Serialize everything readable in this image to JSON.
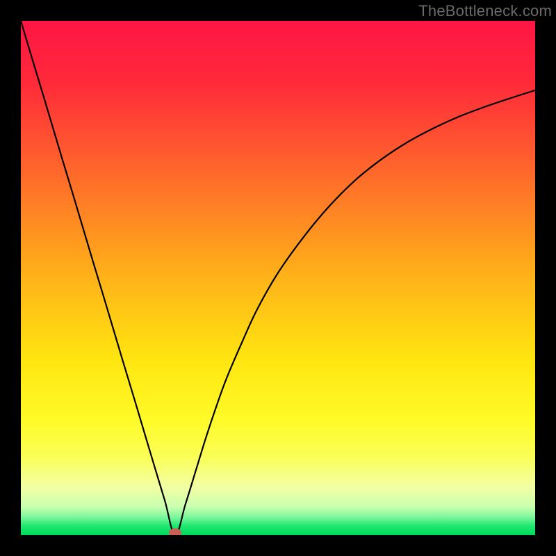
{
  "watermark": "TheBottleneck.com",
  "chart_data": {
    "type": "line",
    "title": "",
    "xlabel": "",
    "ylabel": "",
    "xlim": [
      0,
      100
    ],
    "ylim": [
      0,
      100
    ],
    "gradient_stops": [
      {
        "offset": 0,
        "color": "#ff1544"
      },
      {
        "offset": 0.12,
        "color": "#ff2a3a"
      },
      {
        "offset": 0.3,
        "color": "#ff6a2a"
      },
      {
        "offset": 0.5,
        "color": "#ffb319"
      },
      {
        "offset": 0.66,
        "color": "#ffe610"
      },
      {
        "offset": 0.78,
        "color": "#fffb2a"
      },
      {
        "offset": 0.85,
        "color": "#faff59"
      },
      {
        "offset": 0.905,
        "color": "#f4ffa3"
      },
      {
        "offset": 0.945,
        "color": "#c9ffb0"
      },
      {
        "offset": 0.965,
        "color": "#7cf79c"
      },
      {
        "offset": 0.982,
        "color": "#1fe86f"
      },
      {
        "offset": 1.0,
        "color": "#00d85c"
      }
    ],
    "curve": {
      "minimum_x": 30,
      "series": [
        {
          "x": 0,
          "y": 100.0
        },
        {
          "x": 2,
          "y": 93.3
        },
        {
          "x": 4,
          "y": 86.7
        },
        {
          "x": 6,
          "y": 80.0
        },
        {
          "x": 8,
          "y": 73.3
        },
        {
          "x": 10,
          "y": 66.7
        },
        {
          "x": 12,
          "y": 60.0
        },
        {
          "x": 14,
          "y": 53.3
        },
        {
          "x": 16,
          "y": 46.7
        },
        {
          "x": 18,
          "y": 40.0
        },
        {
          "x": 20,
          "y": 33.3
        },
        {
          "x": 22,
          "y": 26.7
        },
        {
          "x": 24,
          "y": 20.0
        },
        {
          "x": 26,
          "y": 13.3
        },
        {
          "x": 28,
          "y": 6.7
        },
        {
          "x": 30,
          "y": 0.0
        },
        {
          "x": 32,
          "y": 6.0
        },
        {
          "x": 34,
          "y": 12.5
        },
        {
          "x": 36,
          "y": 19.0
        },
        {
          "x": 38,
          "y": 25.0
        },
        {
          "x": 40,
          "y": 30.5
        },
        {
          "x": 43,
          "y": 37.5
        },
        {
          "x": 46,
          "y": 44.0
        },
        {
          "x": 50,
          "y": 51.0
        },
        {
          "x": 55,
          "y": 58.0
        },
        {
          "x": 60,
          "y": 64.0
        },
        {
          "x": 65,
          "y": 69.0
        },
        {
          "x": 70,
          "y": 73.0
        },
        {
          "x": 75,
          "y": 76.3
        },
        {
          "x": 80,
          "y": 79.0
        },
        {
          "x": 85,
          "y": 81.3
        },
        {
          "x": 90,
          "y": 83.2
        },
        {
          "x": 95,
          "y": 84.9
        },
        {
          "x": 100,
          "y": 86.5
        }
      ]
    },
    "marker": {
      "x": 30,
      "y": 0.5,
      "rx": 9,
      "ry": 6,
      "color": "#cb5f56"
    }
  }
}
